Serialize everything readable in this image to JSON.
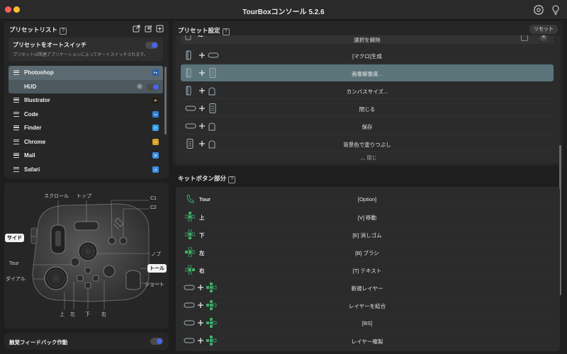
{
  "window": {
    "title": "TourBoxコンソール 5.2.6"
  },
  "preset_list": {
    "title": "プリセットリスト",
    "help": "?",
    "auto_switch": {
      "title": "プリセットをオートスイッチ",
      "description": "プリセットは関連アプリケーションによってオートスイッチされます。",
      "enabled": true
    },
    "items": [
      {
        "label": "Photoshop",
        "icon": "Ps",
        "icon_color": "#2a5ea8",
        "selected": true
      },
      {
        "label": "HUD",
        "sub": true
      },
      {
        "label": "Illustrator",
        "icon": "Ai",
        "icon_color": "#2a1c10"
      },
      {
        "label": "Code",
        "icon": "<>",
        "icon_color": "#2f7fd6"
      },
      {
        "label": "Finder",
        "icon": "F",
        "icon_color": "#3aa0e8"
      },
      {
        "label": "Chrome",
        "icon": "C",
        "icon_color": "#d9a022"
      },
      {
        "label": "Mail",
        "icon": "M",
        "icon_color": "#3b8fe6"
      },
      {
        "label": "Safari",
        "icon": "S",
        "icon_color": "#3b8fe6"
      }
    ]
  },
  "diagram": {
    "labels": {
      "scroll": "スクロール",
      "top": "トップ",
      "c1": "C1",
      "c2": "C2",
      "side": "サイド",
      "knob": "ノブ",
      "tour": "Tour",
      "tall": "トール",
      "dial": "ダイアル",
      "short": "ショート",
      "up": "上",
      "left": "左",
      "down": "下",
      "right": "右"
    }
  },
  "haptic": {
    "label": "触覚フィードバック作動",
    "enabled": true
  },
  "preset_settings": {
    "title": "プリセット設定",
    "help": "?",
    "reset_label": "リセット",
    "partial_row": {
      "combo_text": "x2",
      "action": "選択を解除"
    },
    "rows": [
      {
        "action": "[マクロ]生成",
        "selected": false
      },
      {
        "action": "画像解像度...",
        "selected": true
      },
      {
        "action": "カンバスサイズ...",
        "selected": false
      },
      {
        "action": "閉じる",
        "selected": false
      },
      {
        "action": "保存",
        "selected": false
      },
      {
        "action": "背景色で塗りつぶし",
        "selected": false
      }
    ],
    "collapse_label": "閉じ"
  },
  "kit_buttons": {
    "title": "キットボタン部分",
    "help": "?",
    "rows": [
      {
        "label": "Tour",
        "action": "[Option]"
      },
      {
        "label": "上",
        "action": "[V] 移動"
      },
      {
        "label": "下",
        "action": "[E] 消しゴム"
      },
      {
        "label": "左",
        "action": "[B] ブラシ"
      },
      {
        "label": "右",
        "action": "[T] テキスト"
      },
      {
        "label": "",
        "action": "新規レイヤー"
      },
      {
        "label": "",
        "action": "レイヤーを結合"
      },
      {
        "label": "",
        "action": "[BS]"
      },
      {
        "label": "",
        "action": "レイヤー複製"
      }
    ]
  },
  "colors": {
    "accent": "#4866e8",
    "selected_row": "#5b7479",
    "green": "#3fae6a"
  }
}
